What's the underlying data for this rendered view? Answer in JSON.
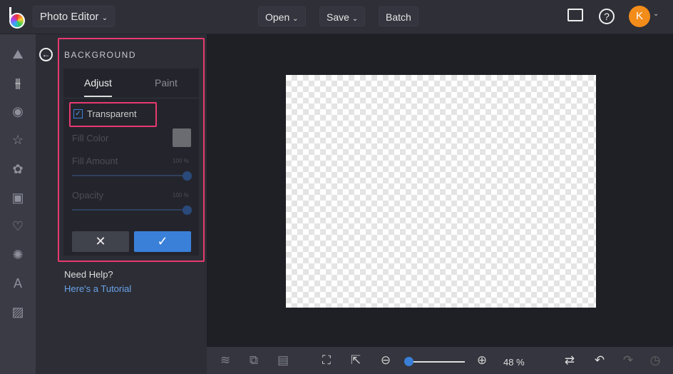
{
  "topbar": {
    "app_menu": "Photo Editor",
    "open": "Open",
    "save": "Save",
    "batch": "Batch",
    "avatar_initial": "K"
  },
  "panel": {
    "title": "BACKGROUND",
    "tabs": [
      {
        "label": "Adjust"
      },
      {
        "label": "Paint"
      }
    ],
    "transparent_label": "Transparent",
    "transparent_checked": true,
    "fill_color_label": "Fill Color",
    "fill_amount_label": "Fill Amount",
    "fill_amount_value": "100 %",
    "opacity_label": "Opacity",
    "opacity_value": "100 %"
  },
  "help": {
    "title": "Need Help?",
    "link": "Here's a Tutorial"
  },
  "bottombar": {
    "zoom_value": "48 %",
    "zoom_fraction": 0.05
  },
  "colors": {
    "accent": "#3a80d9",
    "highlight": "#e8396f",
    "avatar": "#f28c1a"
  }
}
